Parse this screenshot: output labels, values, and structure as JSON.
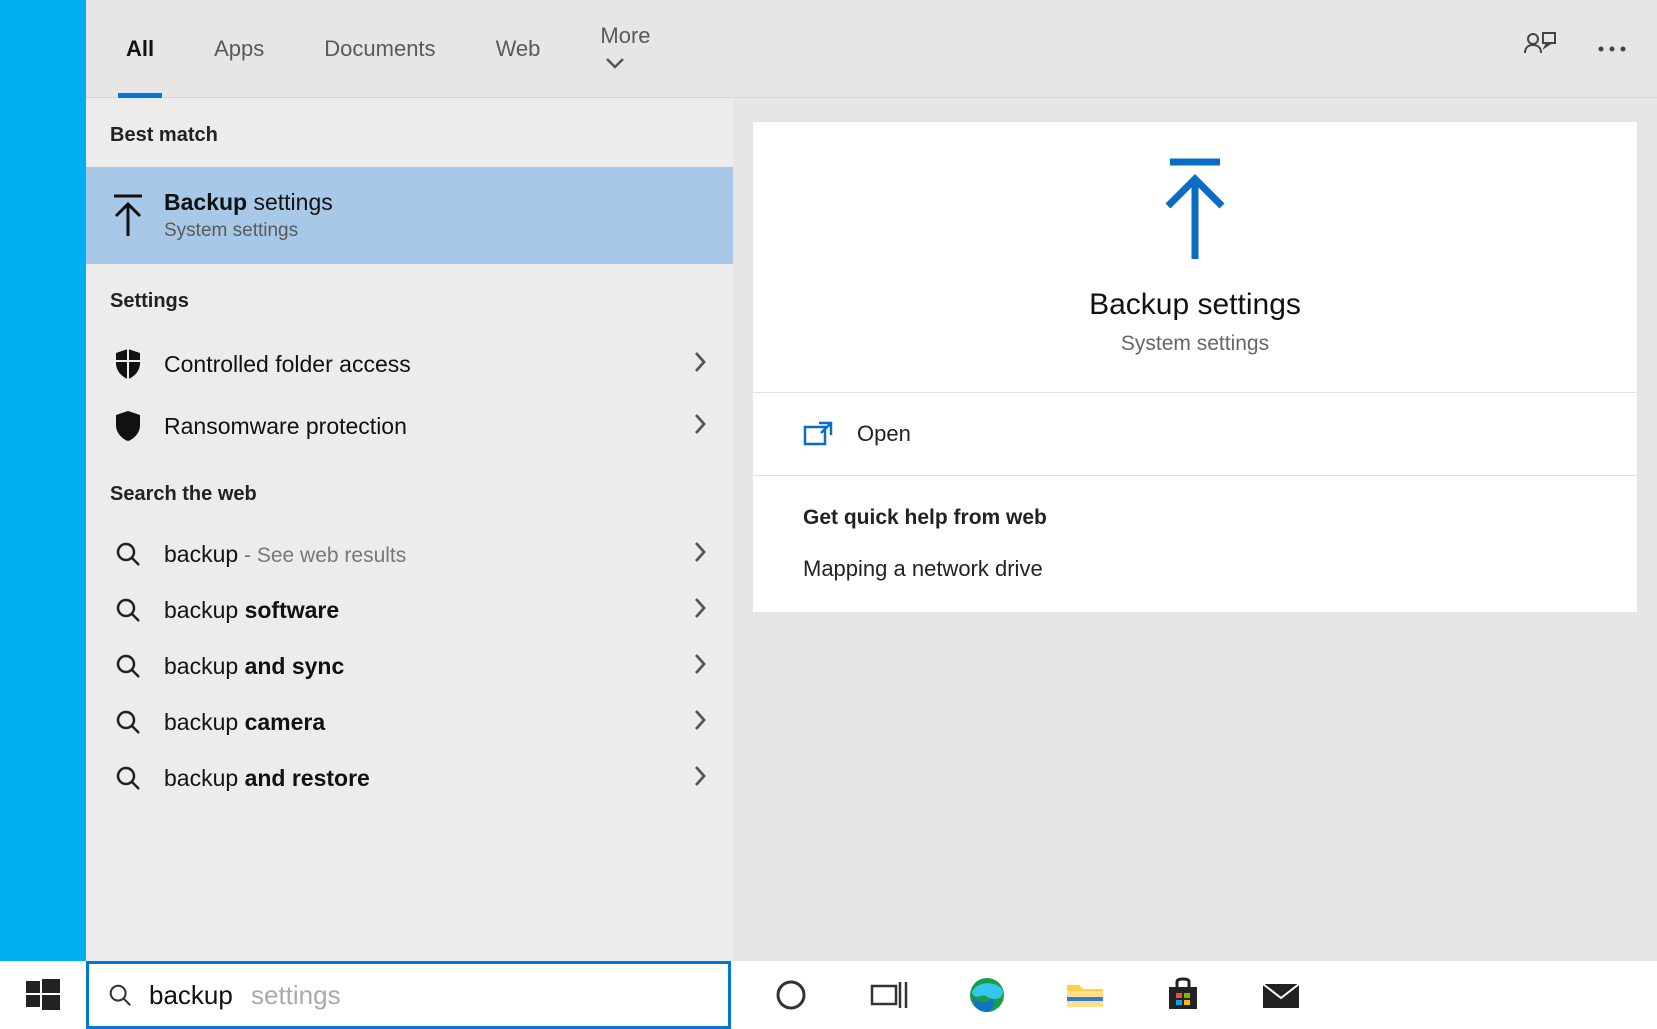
{
  "tabs": {
    "all": "All",
    "apps": "Apps",
    "documents": "Documents",
    "web": "Web",
    "more": "More"
  },
  "sections": {
    "best_match": "Best match",
    "settings": "Settings",
    "search_web": "Search the web"
  },
  "best_match": {
    "title_bold": "Backup",
    "title_rest": " settings",
    "subtitle": "System settings"
  },
  "settings_results": [
    {
      "label": "Controlled folder access"
    },
    {
      "label": "Ransomware protection"
    }
  ],
  "web_results": [
    {
      "prefix": "backup",
      "bold": "",
      "hint": " - See web results"
    },
    {
      "prefix": "backup ",
      "bold": "software",
      "hint": ""
    },
    {
      "prefix": "backup ",
      "bold": "and sync",
      "hint": ""
    },
    {
      "prefix": "backup ",
      "bold": "camera",
      "hint": ""
    },
    {
      "prefix": "backup ",
      "bold": "and restore",
      "hint": ""
    }
  ],
  "preview": {
    "title": "Backup settings",
    "subtitle": "System settings",
    "open_label": "Open",
    "help_heading": "Get quick help from web",
    "help_link_1": "Mapping a network drive"
  },
  "search": {
    "typed": "backup",
    "completion": " settings"
  }
}
